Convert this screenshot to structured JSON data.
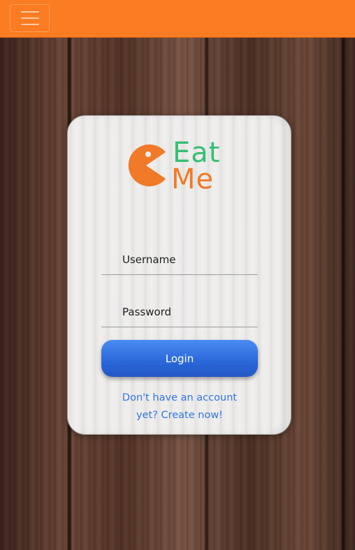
{
  "navbar": {
    "background_color": "#fb7c22",
    "menu_icon": "hamburger-menu-icon"
  },
  "logo": {
    "mark_icon": "pacman-icon",
    "word1": "Eat",
    "word2": "Me",
    "word1_color": "#35bf72",
    "word2_color": "#f07a28",
    "mark_color": "#f07a28"
  },
  "login_form": {
    "username_placeholder": "Username",
    "username_value": "",
    "password_placeholder": "Password",
    "password_value": "",
    "login_label": "Login",
    "login_color": "#2a67d8",
    "signup_text": "Don't have an account yet? Create now!",
    "signup_color": "#2f74e6"
  }
}
